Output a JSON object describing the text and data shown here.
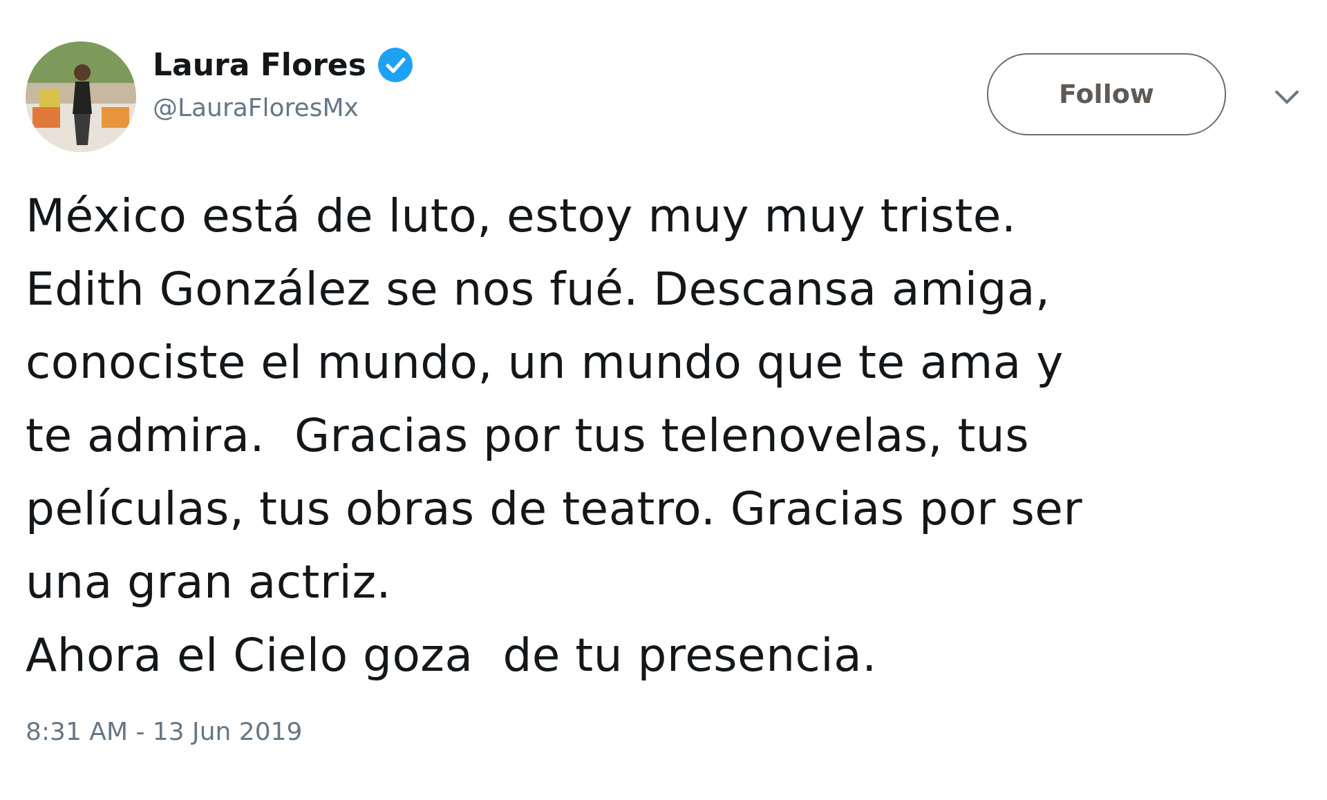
{
  "author": {
    "name": "Laura Flores",
    "verified": true,
    "handle": "@LauraFloresMx"
  },
  "follow_button": {
    "label": "Follow"
  },
  "tweet": {
    "lines": [
      "México está de luto, estoy muy muy triste.",
      "Edith González se nos fué. Descansa amiga,",
      "conociste el mundo, un mundo que te ama y",
      "te admira.  Gracias por tus telenovelas, tus",
      "películas, tus obras de teatro. Gracias por ser",
      "una gran actriz.",
      "Ahora el Cielo goza  de tu presencia."
    ]
  },
  "timestamp": "8:31 AM - 13 Jun 2019"
}
